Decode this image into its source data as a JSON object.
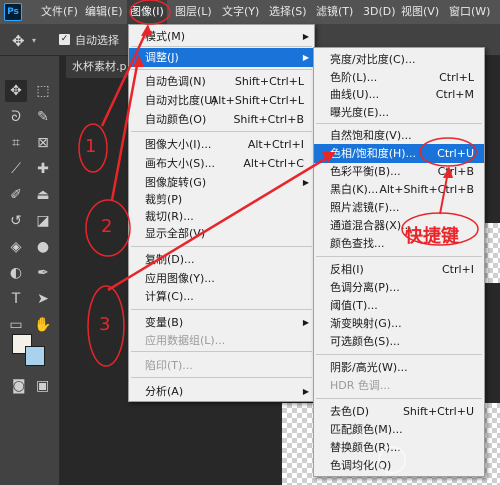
{
  "app": {
    "logo": "Ps",
    "menus": [
      {
        "label": "文件(F)"
      },
      {
        "label": "编辑(E)"
      },
      {
        "label": "图像(I)"
      },
      {
        "label": "图层(L)"
      },
      {
        "label": "文字(Y)"
      },
      {
        "label": "选择(S)"
      },
      {
        "label": "滤镜(T)"
      },
      {
        "label": "3D(D)"
      },
      {
        "label": "视图(V)"
      },
      {
        "label": "窗口(W)"
      }
    ]
  },
  "options_bar": {
    "auto_select_label": "自动选择"
  },
  "document": {
    "tab_label": "水杯素材.p"
  },
  "image_menu": [
    {
      "label": "模式(M)",
      "shortcut": "",
      "submenu": true,
      "disabled": false
    },
    {
      "label": "调整(J)",
      "shortcut": "",
      "submenu": true,
      "disabled": false,
      "highlight": true
    },
    {
      "label": "自动色调(N)",
      "shortcut": "Shift+Ctrl+L",
      "submenu": false,
      "disabled": false
    },
    {
      "label": "自动对比度(U)",
      "shortcut": "Alt+Shift+Ctrl+L",
      "submenu": false,
      "disabled": false
    },
    {
      "label": "自动颜色(O)",
      "shortcut": "Shift+Ctrl+B",
      "submenu": false,
      "disabled": false
    },
    {
      "label": "图像大小(I)...",
      "shortcut": "Alt+Ctrl+I",
      "submenu": false,
      "disabled": false
    },
    {
      "label": "画布大小(S)...",
      "shortcut": "Alt+Ctrl+C",
      "submenu": false,
      "disabled": false
    },
    {
      "label": "图像旋转(G)",
      "shortcut": "",
      "submenu": true,
      "disabled": false
    },
    {
      "label": "裁剪(P)",
      "shortcut": "",
      "submenu": false,
      "disabled": false
    },
    {
      "label": "裁切(R)...",
      "shortcut": "",
      "submenu": false,
      "disabled": false
    },
    {
      "label": "显示全部(V)",
      "shortcut": "",
      "submenu": false,
      "disabled": false
    },
    {
      "label": "复制(D)...",
      "shortcut": "",
      "submenu": false,
      "disabled": false
    },
    {
      "label": "应用图像(Y)...",
      "shortcut": "",
      "submenu": false,
      "disabled": false
    },
    {
      "label": "计算(C)...",
      "shortcut": "",
      "submenu": false,
      "disabled": false
    },
    {
      "label": "变量(B)",
      "shortcut": "",
      "submenu": true,
      "disabled": false
    },
    {
      "label": "应用数据组(L)...",
      "shortcut": "",
      "submenu": false,
      "disabled": true
    },
    {
      "label": "陷印(T)...",
      "shortcut": "",
      "submenu": false,
      "disabled": true
    },
    {
      "label": "分析(A)",
      "shortcut": "",
      "submenu": true,
      "disabled": false
    }
  ],
  "adjust_menu": [
    {
      "label": "亮度/对比度(C)...",
      "shortcut": ""
    },
    {
      "label": "色阶(L)...",
      "shortcut": "Ctrl+L"
    },
    {
      "label": "曲线(U)...",
      "shortcut": "Ctrl+M"
    },
    {
      "label": "曝光度(E)...",
      "shortcut": ""
    },
    {
      "label": "自然饱和度(V)...",
      "shortcut": ""
    },
    {
      "label": "色相/饱和度(H)...",
      "shortcut": "Ctrl+U",
      "highlight": true
    },
    {
      "label": "色彩平衡(B)...",
      "shortcut": "Ctrl+B"
    },
    {
      "label": "黑白(K)...",
      "shortcut": "Alt+Shift+Ctrl+B"
    },
    {
      "label": "照片滤镜(F)...",
      "shortcut": ""
    },
    {
      "label": "通道混合器(X)...",
      "shortcut": ""
    },
    {
      "label": "颜色查找...",
      "shortcut": ""
    },
    {
      "label": "反相(I)",
      "shortcut": "Ctrl+I"
    },
    {
      "label": "色调分离(P)...",
      "shortcut": ""
    },
    {
      "label": "阈值(T)...",
      "shortcut": ""
    },
    {
      "label": "渐变映射(G)...",
      "shortcut": ""
    },
    {
      "label": "可选颜色(S)...",
      "shortcut": ""
    },
    {
      "label": "阴影/高光(W)...",
      "shortcut": ""
    },
    {
      "label": "HDR 色调...",
      "shortcut": "",
      "disabled": true
    },
    {
      "label": "去色(D)",
      "shortcut": "Shift+Ctrl+U"
    },
    {
      "label": "匹配颜色(M)...",
      "shortcut": ""
    },
    {
      "label": "替换颜色(R)...",
      "shortcut": ""
    },
    {
      "label": "色调均化(Q)",
      "shortcut": ""
    }
  ],
  "annotations": {
    "hotkey_label": "快捷键",
    "step1": "1",
    "step2": "2",
    "step3": "3",
    "color": "#e8262a"
  }
}
